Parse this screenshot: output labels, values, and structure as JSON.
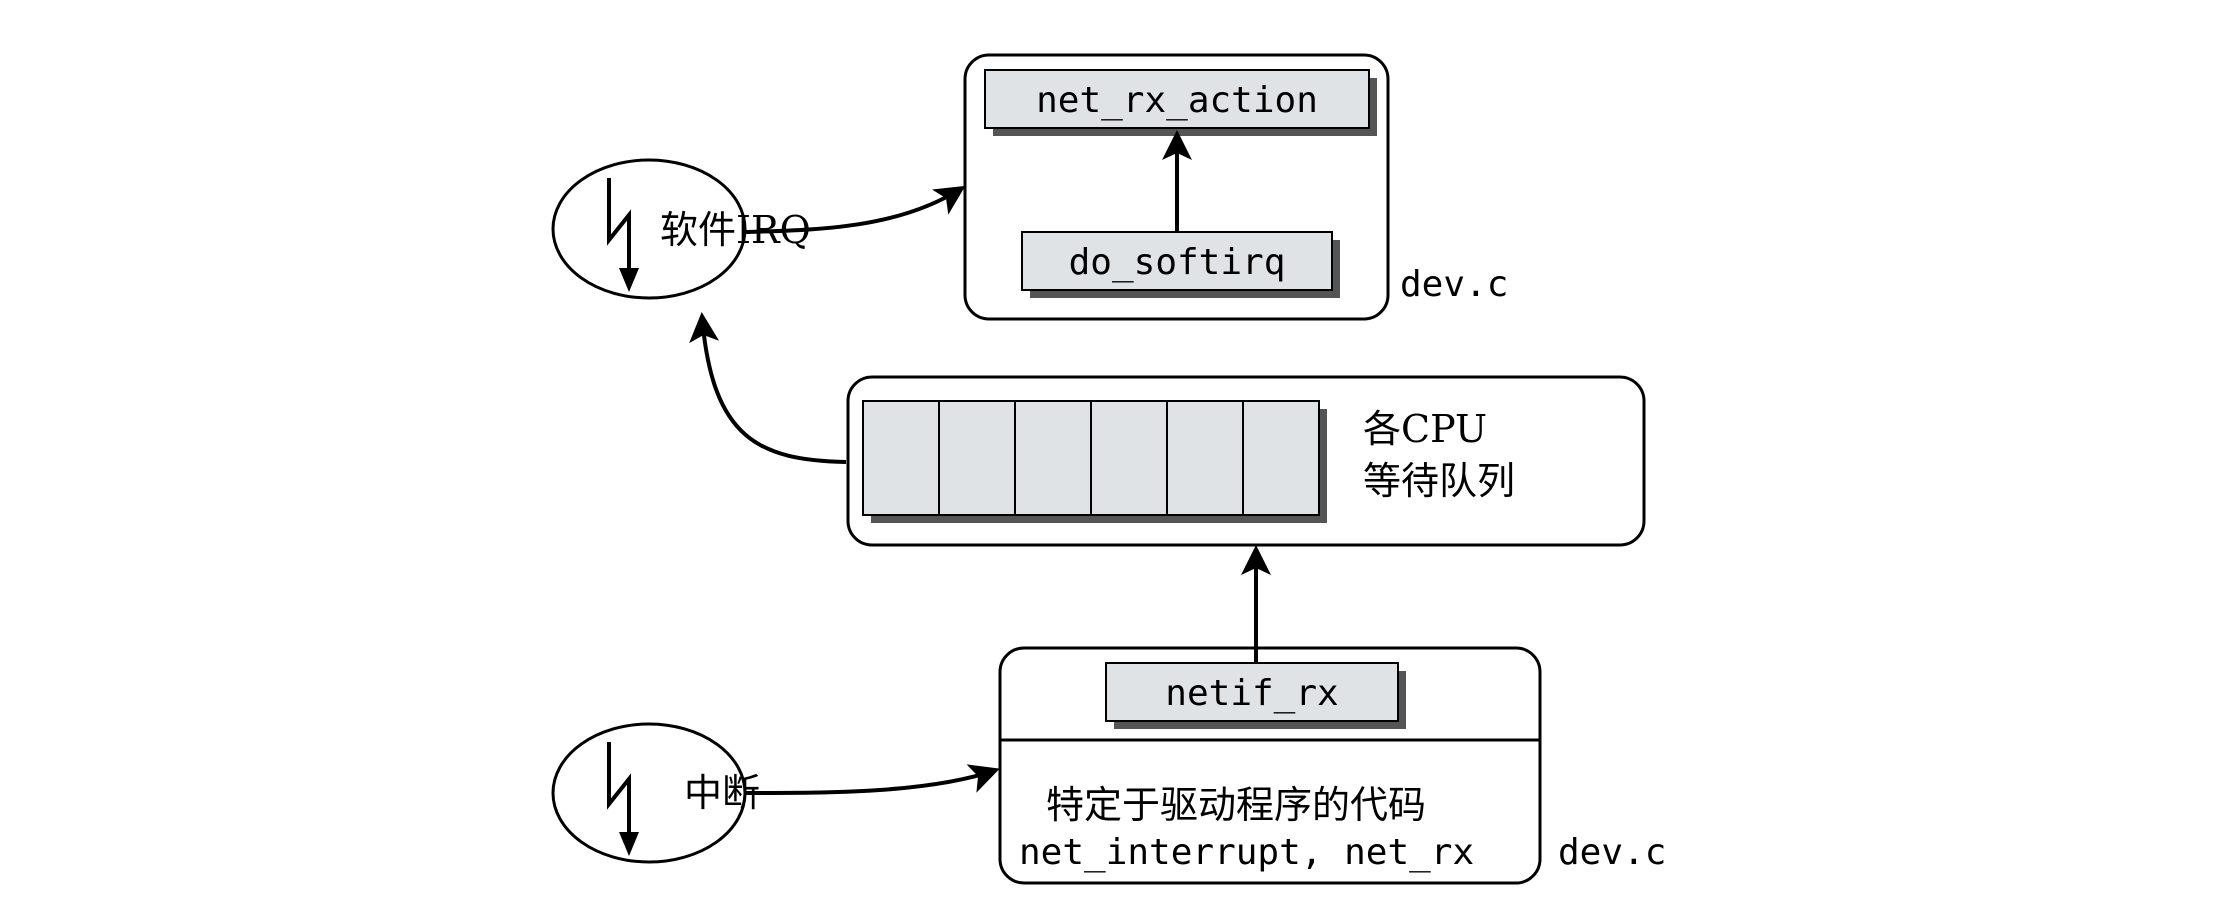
{
  "softirq": {
    "label": "软件IRQ",
    "net_rx_action": "net_rx_action",
    "do_softirq": "do_softirq",
    "file": "dev.c"
  },
  "queue": {
    "line1": "各CPU",
    "line2": "等待队列",
    "slots": 6
  },
  "driver": {
    "interrupt_label": "中断",
    "netif_rx": "netif_rx",
    "code_label": "特定于驱动程序的代码",
    "functions": "net_interrupt, net_rx",
    "file": "dev.c"
  },
  "colors": {
    "box_fill": "#dfe3e6",
    "shadow": "#555555",
    "stroke": "#000000"
  }
}
